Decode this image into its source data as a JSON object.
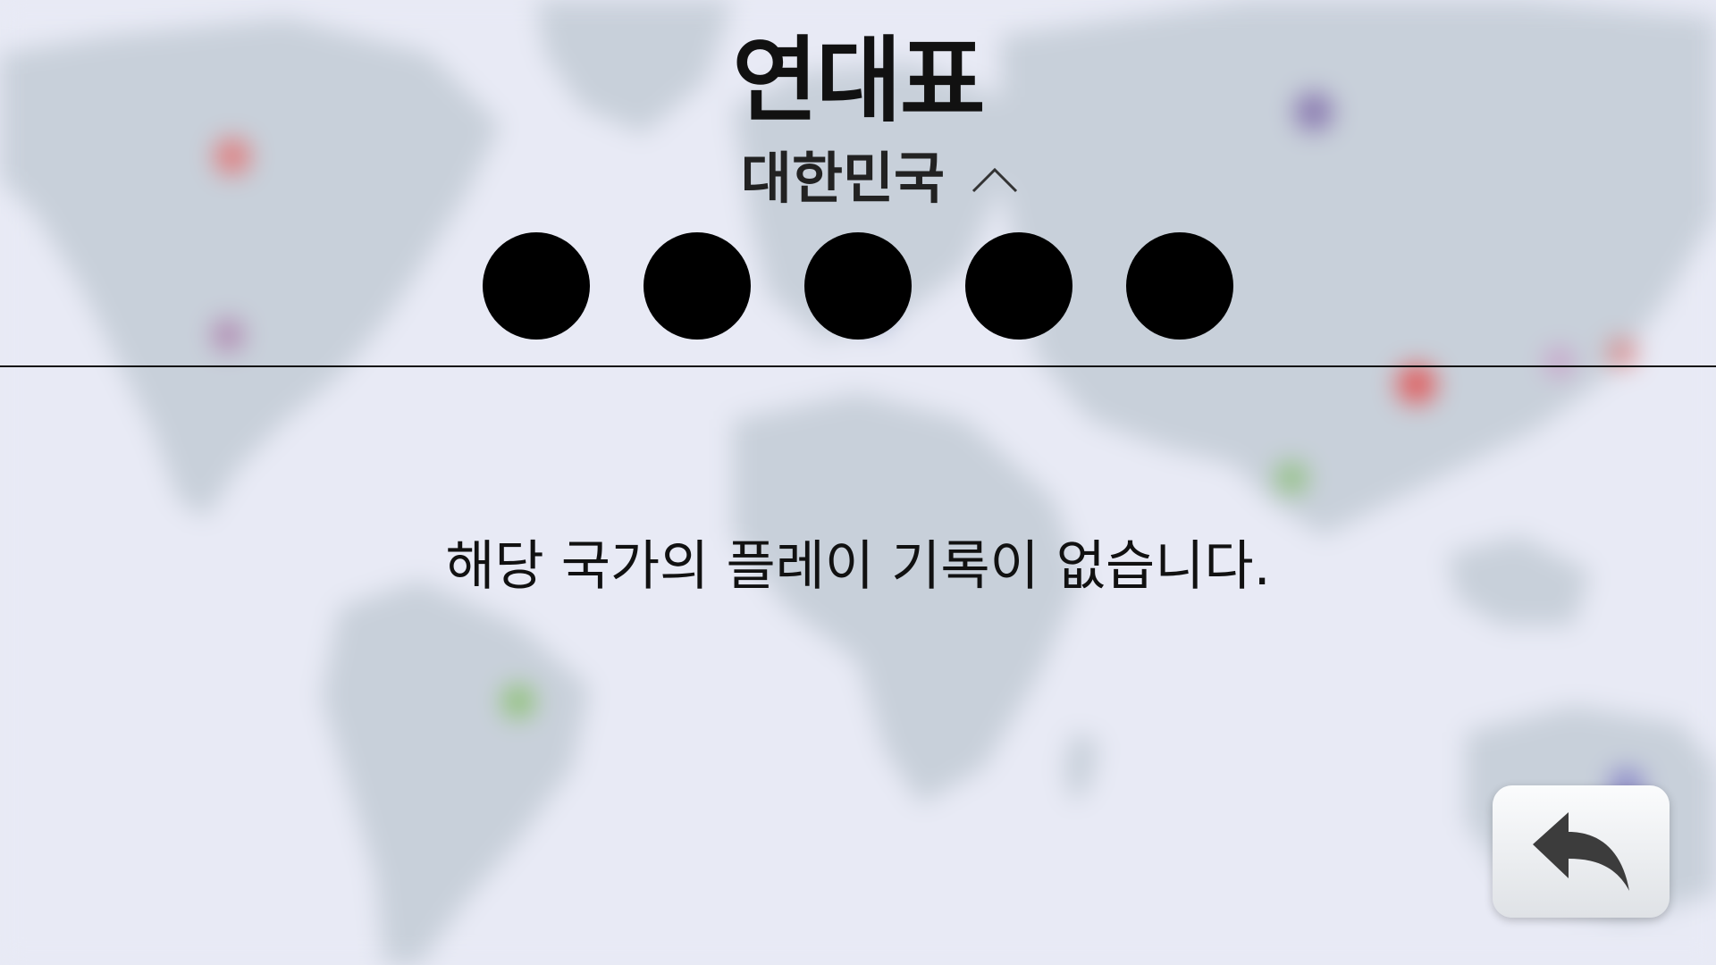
{
  "screen": {
    "title": "연대표",
    "country_selector": {
      "selected": "대한민국",
      "expand_icon": "chevron-up-icon"
    },
    "progress_dots": {
      "count": 5
    },
    "empty_message": "해당 국가의 플레이 기록이 없습니다.",
    "back_button": {
      "icon": "back-arrow-icon"
    }
  },
  "colors": {
    "background": "#e8eaf5",
    "landmass": "#c8d0da",
    "text": "#111111",
    "dot": "#000000",
    "button_icon": "#3c3c3c"
  }
}
